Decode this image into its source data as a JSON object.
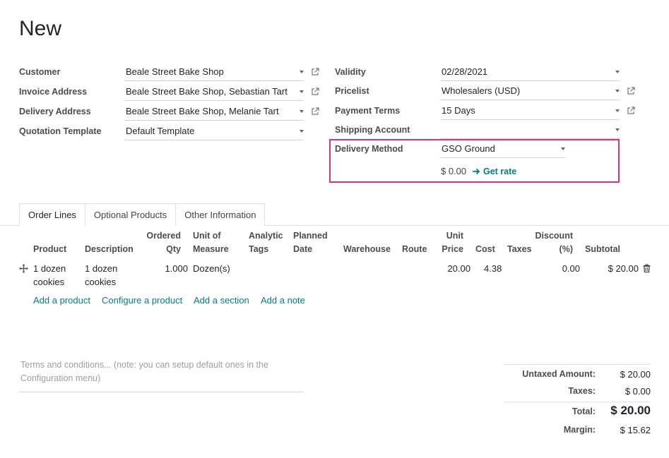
{
  "page_title": "New",
  "left_fields": [
    {
      "label": "Customer",
      "value": "Beale Street Bake Shop"
    },
    {
      "label": "Invoice Address",
      "value": "Beale Street Bake Shop, Sebastian Tart"
    },
    {
      "label": "Delivery Address",
      "value": "Beale Street Bake Shop, Melanie Tart"
    },
    {
      "label": "Quotation Template",
      "value": "Default Template"
    }
  ],
  "right_fields": [
    {
      "label": "Validity",
      "value": "02/28/2021"
    },
    {
      "label": "Pricelist",
      "value": "Wholesalers (USD)"
    },
    {
      "label": "Payment Terms",
      "value": "15 Days"
    },
    {
      "label": "Shipping Account",
      "value": ""
    }
  ],
  "delivery": {
    "label": "Delivery Method",
    "value": "GSO Ground",
    "rate": "$ 0.00",
    "get_rate_label": "Get rate"
  },
  "tabs": [
    "Order Lines",
    "Optional Products",
    "Other Information"
  ],
  "columns": {
    "product": "Product",
    "description": "Description",
    "ordered_qty_1": "Ordered",
    "ordered_qty_2": "Qty",
    "uom_1": "Unit of",
    "uom_2": "Measure",
    "analytic_1": "Analytic",
    "analytic_2": "Tags",
    "planned_1": "Planned",
    "planned_2": "Date",
    "warehouse": "Warehouse",
    "route": "Route",
    "unit_price_1": "Unit",
    "unit_price_2": "Price",
    "cost": "Cost",
    "taxes": "Taxes",
    "discount_1": "Discount",
    "discount_2": "(%)",
    "subtotal": "Subtotal"
  },
  "rows": [
    {
      "product_1": "1 dozen",
      "product_2": "cookies",
      "description_1": "1 dozen",
      "description_2": "cookies",
      "qty": "1.000",
      "uom": "Dozen(s)",
      "unit_price": "20.00",
      "cost": "4.38",
      "discount": "0.00",
      "subtotal": "$ 20.00"
    }
  ],
  "line_actions": [
    "Add a product",
    "Configure a product",
    "Add a section",
    "Add a note"
  ],
  "terms_placeholder_1": "Terms and conditions... (note: you can setup default ones in the",
  "terms_placeholder_2": "Configuration menu)",
  "totals": {
    "untaxed_label": "Untaxed Amount:",
    "untaxed_value": "$ 20.00",
    "taxes_label": "Taxes:",
    "taxes_value": "$ 0.00",
    "total_label": "Total:",
    "total_value": "$ 20.00",
    "margin_label": "Margin:",
    "margin_value": "$ 15.62"
  },
  "colors": {
    "accent": "#017e84",
    "highlight": "#d6357f"
  }
}
